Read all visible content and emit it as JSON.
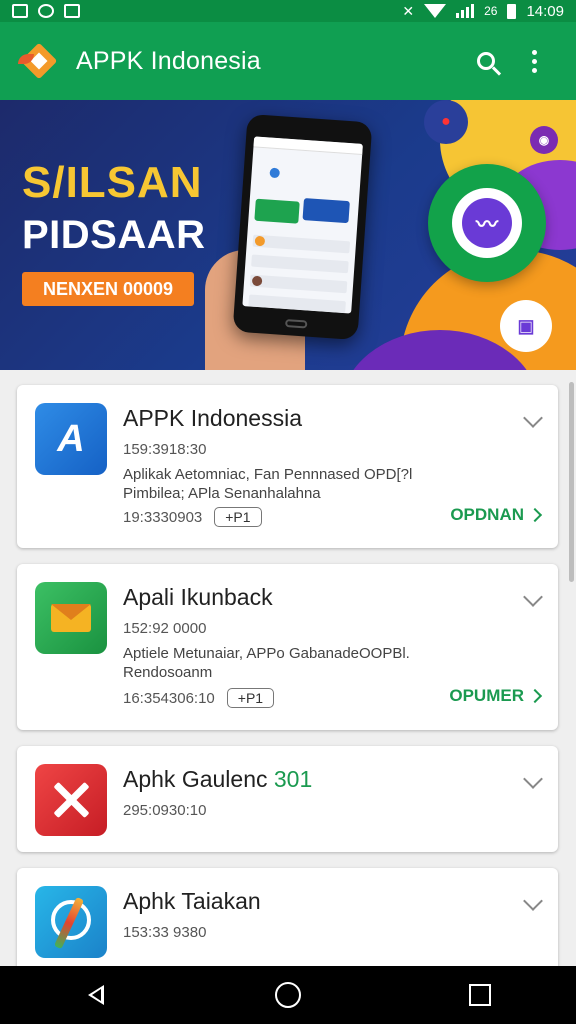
{
  "status_bar": {
    "time": "14:09",
    "battery_text": "26"
  },
  "app_bar": {
    "title": "APPK Indonesia",
    "logo_icon": "apk-diamond-logo-icon",
    "search_icon": "search-icon",
    "menu_icon": "more-vert-icon"
  },
  "banner": {
    "headline": "S/ILSAN",
    "subheadline": "PIDSAAR",
    "button_label": "NENXEN 00009",
    "colors": {
      "background": "#1b3b8c",
      "headline": "#f7c733",
      "button": "#f47f20"
    }
  },
  "apps": [
    {
      "title": "APPK Indonessia",
      "meta": "159:3918:30",
      "description": "Aplikak Aetomniac, Fan Pennnased OPD[?l Pimbilea; APla Senanhalahna",
      "meta2": "19:3330903",
      "chip": "+P1",
      "action": "OPDNAN",
      "icon": "blue-a-icon"
    },
    {
      "title": "Apali Ikunback",
      "meta": "152:92 0000",
      "description": "Aptiele Metunaiar, APPo GabanadeOOPBl. Rendosoanm",
      "meta2": "16:354306:10",
      "chip": "+P1",
      "action": "OPUMER",
      "icon": "mail-envelope-icon"
    },
    {
      "title_main": "Aphk Gaulenc",
      "title_accent": "301",
      "meta": "295:0930:10",
      "icon": "blocked-x-icon"
    },
    {
      "title": "Aphk Taiakan",
      "meta": "153:33 9380",
      "icon": "pen-compass-icon"
    }
  ],
  "nav": {
    "back_icon": "back-triangle-icon",
    "home_icon": "home-circle-icon",
    "recent_icon": "recent-square-icon"
  },
  "theme": {
    "primary": "#109f52",
    "status": "#0b8d43",
    "accent_text": "#1b9a50"
  }
}
